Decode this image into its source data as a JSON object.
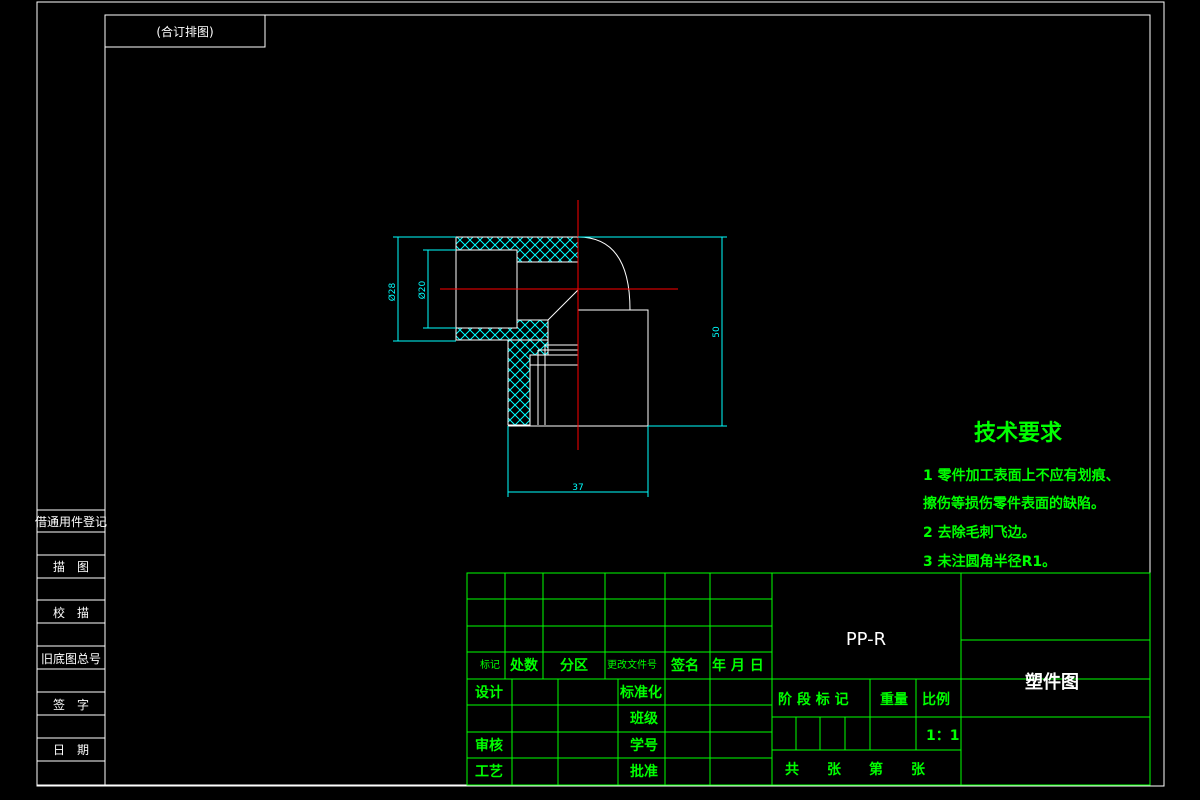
{
  "drawing_title_box": "(合订排图)",
  "side_panel": {
    "rows": [
      "借通用件登记",
      "描　图",
      "校　描",
      "旧底图总号",
      "签　字",
      "日　期"
    ]
  },
  "part": {
    "material": "PP-R",
    "name": "塑件图"
  },
  "dimensions": {
    "outer_diameter": "Ø28",
    "inner_diameter": "Ø20",
    "height": "50",
    "width": "37"
  },
  "tech_requirements": {
    "title": "技术要求",
    "items": [
      "1 零件加工表面上不应有划痕、",
      "擦伤等损伤零件表面的缺陷。",
      "2 去除毛刺飞边。",
      "3 未注圆角半径R1。"
    ]
  },
  "title_block": {
    "rev_headers": {
      "mark": "标记",
      "count": "处数",
      "zone": "分区",
      "doc_no": "更改文件号",
      "sign": "签名",
      "date": "年 月 日"
    },
    "design": "设计",
    "standardize": "标准化",
    "class": "班级",
    "review": "审核",
    "student_id": "学号",
    "process": "工艺",
    "approve": "批准",
    "stage_mark": "阶 段 标 记",
    "weight": "重量",
    "scale_label": "比例",
    "scale_value": "1：1",
    "sheets": "共　　张　　第　　张"
  },
  "colors": {
    "frame": "#ffffff",
    "table": "#00ff00",
    "dimension": "#00ffff",
    "centerline": "#ff0000",
    "hatch": "#00ffff"
  }
}
